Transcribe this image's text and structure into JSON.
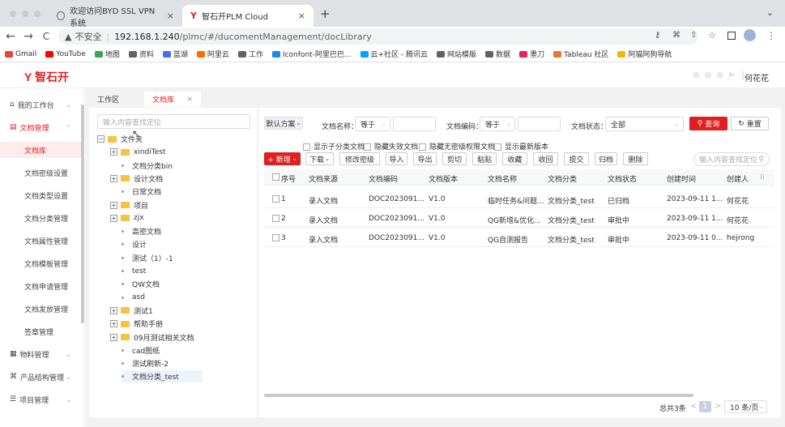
{
  "browser": {
    "tabs": [
      {
        "title": "欢迎访问BYD SSL VPN系统",
        "icon": "globe-icon"
      },
      {
        "title": "智石开PLM Cloud",
        "icon": "plm-logo-icon"
      }
    ],
    "new_tab": "+",
    "close": "×",
    "tab_menu": "⌄",
    "nav": {
      "back": "←",
      "forward": "→",
      "reload": "C"
    },
    "url": {
      "security": "不安全",
      "separator": "|",
      "host": "192.168.1.240",
      "path": "/plmc/#/ducomentManagement/docLibrary"
    },
    "bookmarks": [
      {
        "label": "Gmail",
        "color": "#ea4335"
      },
      {
        "label": "YouTube",
        "color": "#ff0000"
      },
      {
        "label": "地图",
        "color": "#34a853"
      },
      {
        "label": "资料",
        "color": "#5f6368"
      },
      {
        "label": "蓝湖",
        "color": "#4a6cf7"
      },
      {
        "label": "阿里云",
        "color": "#ff6a00"
      },
      {
        "label": "工作",
        "color": "#5f6368"
      },
      {
        "label": "Iconfont-阿里巴巴...",
        "color": "#1e88e5"
      },
      {
        "label": "云+社区 - 腾讯云",
        "color": "#00a3ff"
      },
      {
        "label": "网站模版",
        "color": "#5f6368"
      },
      {
        "label": "数据",
        "color": "#5f6368"
      },
      {
        "label": "墨刀",
        "color": "#e91e63"
      },
      {
        "label": "Tableau 社区",
        "color": "#e8762d"
      },
      {
        "label": "阿猫阿狗导航",
        "color": "#f5b700"
      }
    ]
  },
  "app": {
    "logo": "智石开",
    "user": "何花花",
    "header_icons": "◎ ◎ ◎ ⊳",
    "header_sep": "|"
  },
  "sidebar": {
    "items": [
      {
        "label": "我的工作台",
        "type": "group",
        "icon": "home-icon",
        "chevron": "⌄"
      },
      {
        "label": "文档管理",
        "type": "group",
        "icon": "doc-icon",
        "active_group": true,
        "chevron": "⌃"
      },
      {
        "label": "文档库",
        "type": "sub",
        "active": true
      },
      {
        "label": "文档密级设置",
        "type": "sub"
      },
      {
        "label": "文档类型设置",
        "type": "sub"
      },
      {
        "label": "文档分类管理",
        "type": "sub"
      },
      {
        "label": "文档属性管理",
        "type": "sub"
      },
      {
        "label": "文档模板管理",
        "type": "sub"
      },
      {
        "label": "文档申请管理",
        "type": "sub"
      },
      {
        "label": "文档发放管理",
        "type": "sub"
      },
      {
        "label": "签章管理",
        "type": "sub"
      },
      {
        "label": "物料管理",
        "type": "group",
        "icon": "box-icon",
        "chevron": "⌄"
      },
      {
        "label": "产品结构管理",
        "type": "group",
        "icon": "tree-icon",
        "chevron": "⌄"
      },
      {
        "label": "项目管理",
        "type": "group",
        "icon": "project-icon",
        "chevron": "⌄"
      }
    ]
  },
  "content_tabs": [
    {
      "label": "工作区"
    },
    {
      "label": "文档库",
      "close": "×",
      "active": true
    }
  ],
  "tree": {
    "search_placeholder": "输入内容查找定位",
    "nodes": [
      {
        "label": "文件夹",
        "kind": "folder",
        "toggle": "−",
        "depth": 0
      },
      {
        "label": "xindiTest",
        "kind": "folder",
        "toggle": "+",
        "depth": 1
      },
      {
        "label": "文档分类bin",
        "kind": "leaf",
        "depth": 1
      },
      {
        "label": "设计文档",
        "kind": "folder",
        "toggle": "+",
        "depth": 1
      },
      {
        "label": "日常文档",
        "kind": "leaf",
        "depth": 1
      },
      {
        "label": "项目",
        "kind": "folder",
        "toggle": "+",
        "depth": 1
      },
      {
        "label": "zjx",
        "kind": "folder",
        "toggle": "+",
        "depth": 1
      },
      {
        "label": "高密文档",
        "kind": "leaf",
        "depth": 1
      },
      {
        "label": "设计",
        "kind": "leaf",
        "depth": 1
      },
      {
        "label": "测试（1）-1",
        "kind": "leaf",
        "depth": 1
      },
      {
        "label": "test",
        "kind": "leaf",
        "depth": 1
      },
      {
        "label": "QW文档",
        "kind": "leaf",
        "depth": 1
      },
      {
        "label": "asd",
        "kind": "leaf",
        "depth": 1
      },
      {
        "label": "测试1",
        "kind": "folder",
        "toggle": "+",
        "depth": 1
      },
      {
        "label": "帮助手册",
        "kind": "folder",
        "toggle": "+",
        "depth": 1
      },
      {
        "label": "09月测试相关文档",
        "kind": "folder",
        "toggle": "+",
        "depth": 1
      },
      {
        "label": "cad图纸",
        "kind": "leaf",
        "depth": 1
      },
      {
        "label": "测试刷新-2",
        "kind": "leaf",
        "depth": 1
      },
      {
        "label": "文档分类_test",
        "kind": "leaf",
        "depth": 1,
        "selected": true
      }
    ]
  },
  "filters": {
    "scheme": "默认方案",
    "scheme_chevron": "⌄",
    "name_label": "文档名称：",
    "name_op": "等于",
    "code_label": "文档编码：",
    "code_op": "等于",
    "status_label": "文档状态：",
    "status_value": "全部",
    "query": "查询",
    "reset": "重置",
    "checkboxes": [
      "显示子分类文档",
      "隐藏失效文档",
      "隐藏无密级权限文档",
      "显示最新版本"
    ]
  },
  "toolbar": {
    "new": "+ 新增",
    "buttons": [
      "下载",
      "修改密级",
      "导入",
      "导出",
      "剪切",
      "粘贴",
      "收藏",
      "收回",
      "提交",
      "归档",
      "删除"
    ],
    "search_placeholder": "输入内容查找定位"
  },
  "table": {
    "columns": [
      "序号",
      "文档来源",
      "文档编码",
      "文档版本",
      "文档名称",
      "文档分类",
      "文档状态",
      "创建时间",
      "创建人"
    ],
    "rows": [
      {
        "no": "1",
        "source": "录入文档",
        "code": "DOC2023091...",
        "version": "V1.0",
        "name": "临时任务&问题...",
        "category": "文档分类_test",
        "status": "已归档",
        "created": "2023-09-11 1...",
        "creator": "何花花"
      },
      {
        "no": "2",
        "source": "录入文档",
        "code": "DOC2023091...",
        "version": "V1.0",
        "name": "QG新增&优化...",
        "category": "文档分类_test",
        "status": "审批中",
        "created": "2023-09-11 1...",
        "creator": "何花花"
      },
      {
        "no": "3",
        "source": "录入文档",
        "code": "DOC2023091...",
        "version": "V1.0",
        "name": "QG自测报告",
        "category": "文档分类_test",
        "status": "审批中",
        "created": "2023-09-11 0...",
        "creator": "hejrong"
      }
    ]
  },
  "pagination": {
    "total": "总共3条",
    "prev": "<",
    "page": "1",
    "next": ">",
    "size": "10 条/页"
  },
  "colors": {
    "brand": "#e02020",
    "active_bg": "#fdecec",
    "link": "#e02020"
  }
}
